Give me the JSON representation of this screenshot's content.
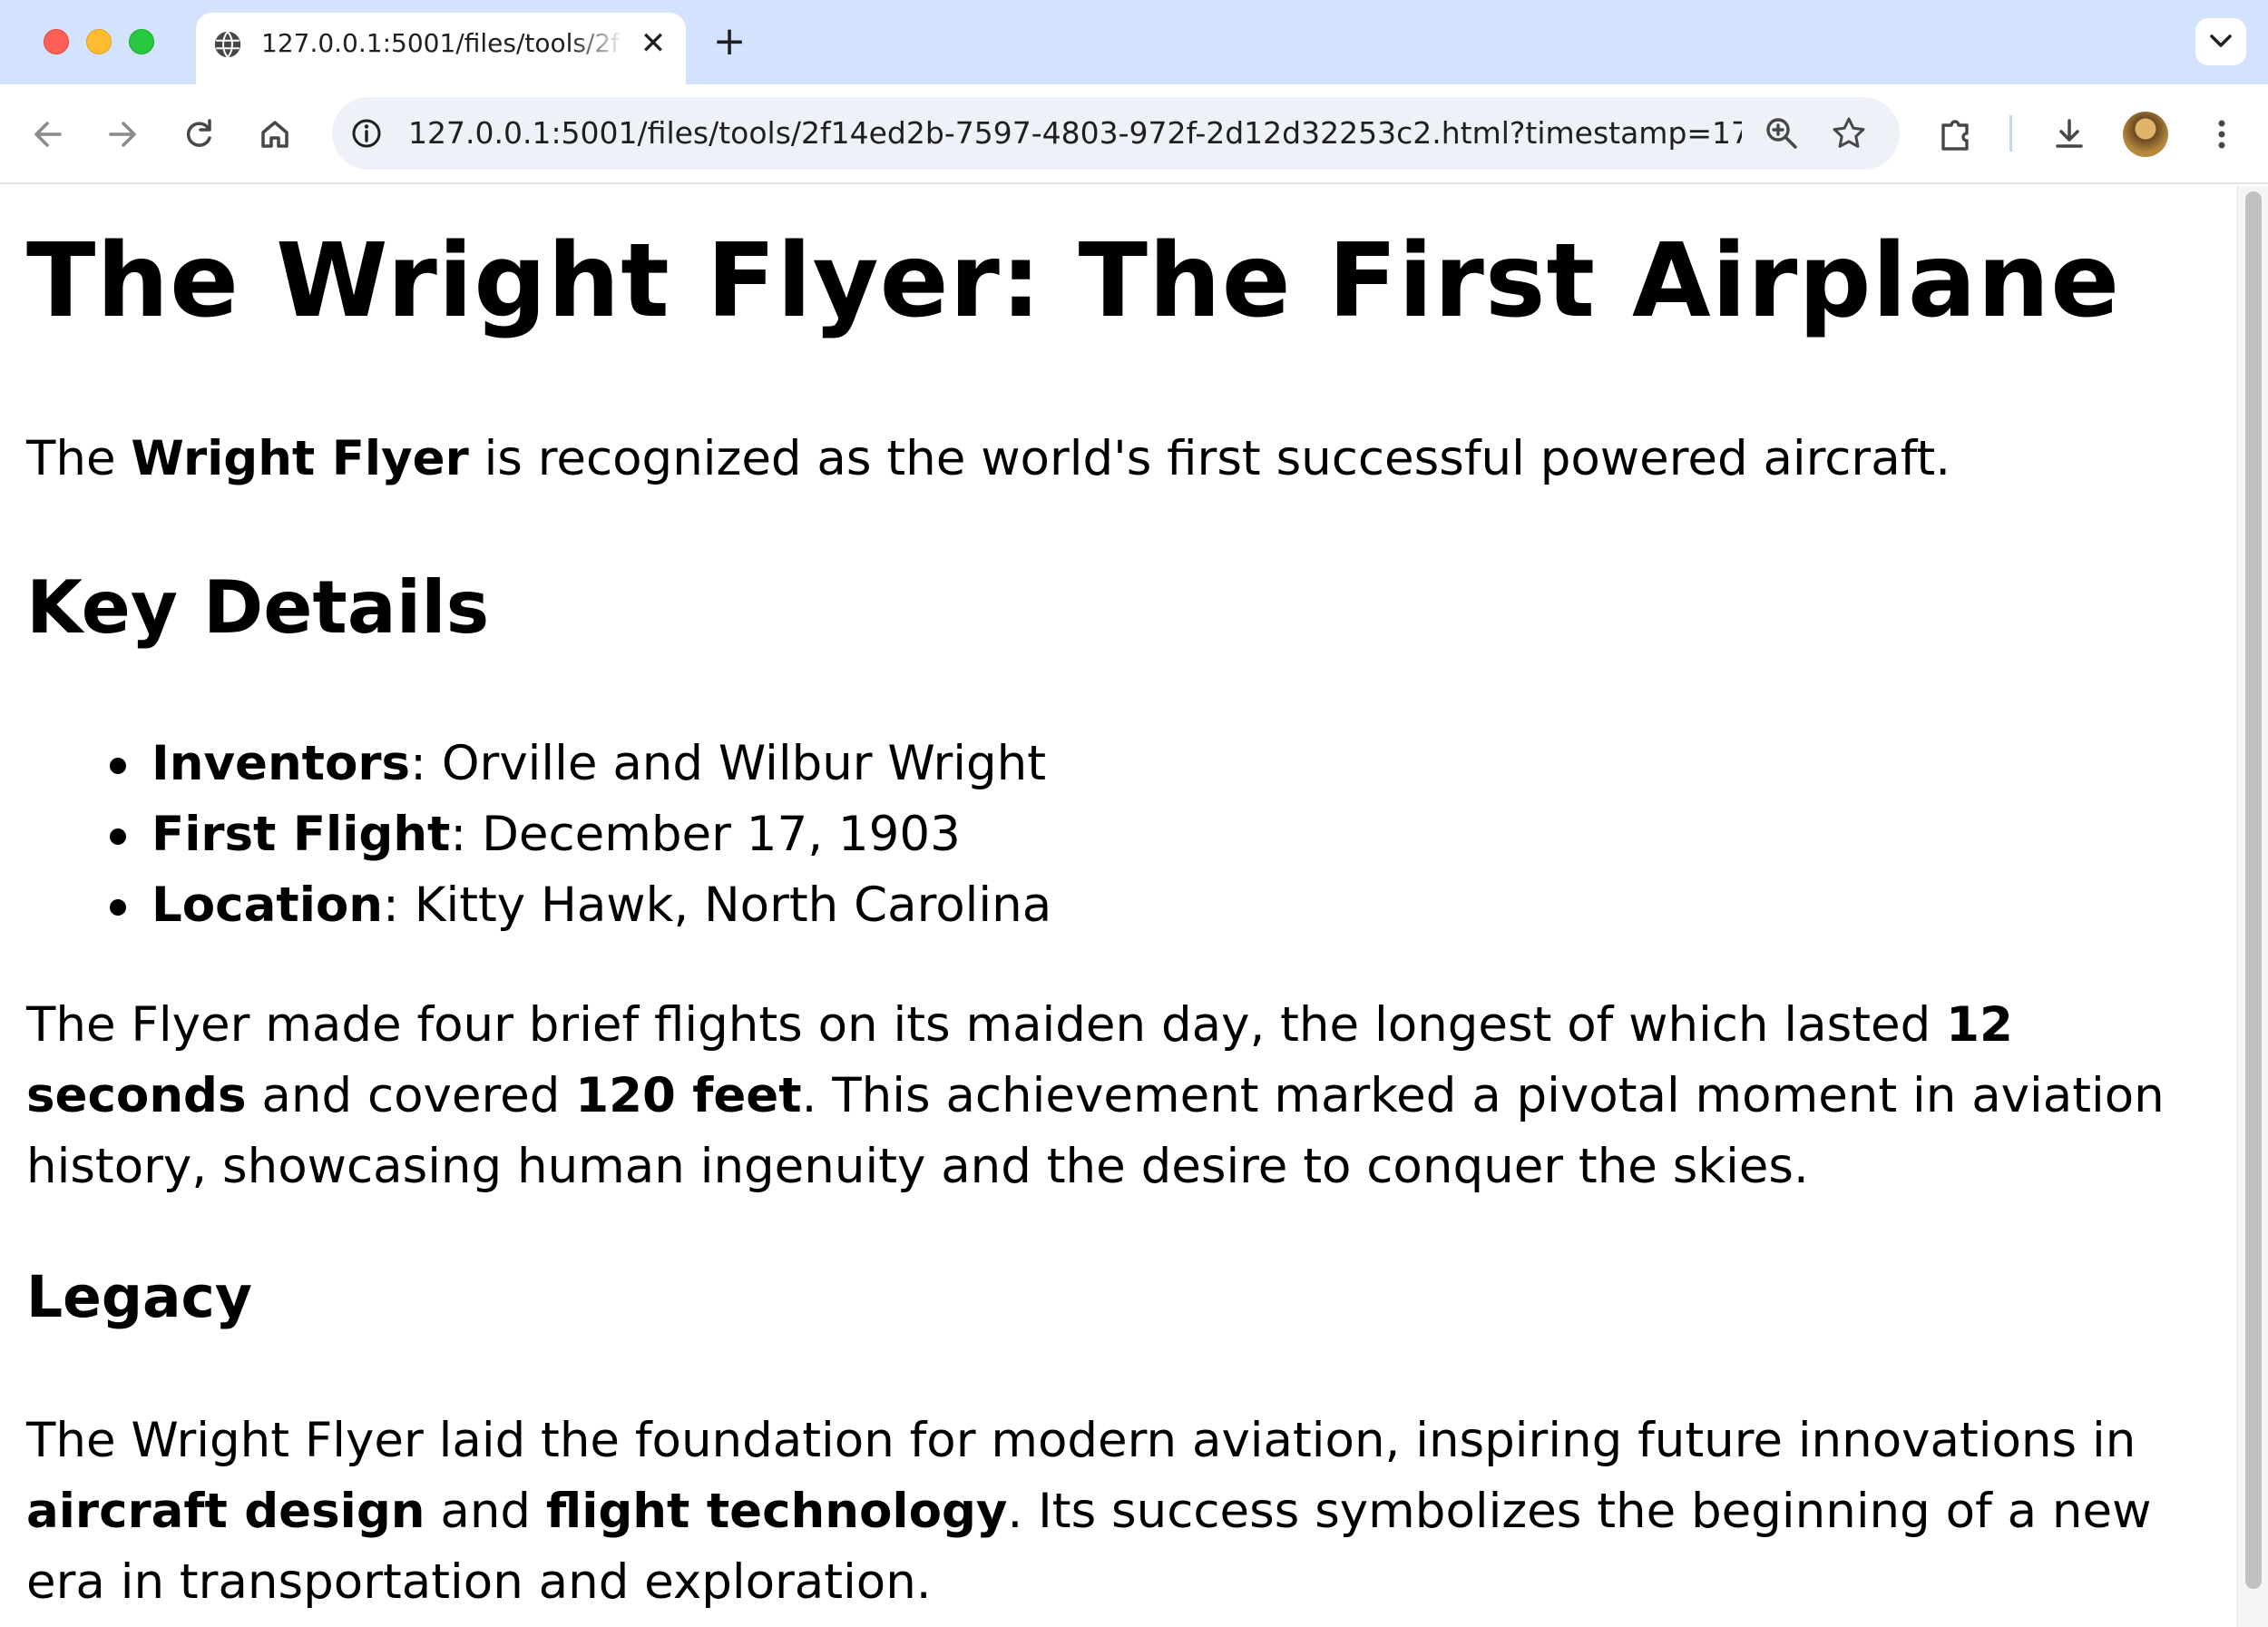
{
  "browser": {
    "tab_title": "127.0.0.1:5001/files/tools/2f14ed2b-7597-4803-972f-2d12d32253c2.html",
    "url": "127.0.0.1:5001/files/tools/2f14ed2b-7597-4803-972f-2d12d32253c2.html?timestamp=17426...",
    "new_tab_symbol": "+",
    "close_tab_symbol": "✕",
    "icons": [
      "globe-icon",
      "back-icon",
      "forward-icon",
      "reload-icon",
      "home-icon",
      "site-info-icon",
      "zoom-icon",
      "bookmark-star-icon",
      "extensions-icon",
      "download-icon",
      "avatar",
      "menu-icon",
      "tab-search-icon"
    ]
  },
  "page": {
    "title": "The Wright Flyer: The First Airplane",
    "intro": {
      "before": "The ",
      "bold": "Wright Flyer",
      "after": " is recognized as the world's first successful powered aircraft."
    },
    "key_details_heading": "Key Details",
    "details": [
      {
        "label": "Inventors",
        "value": ": Orville and Wilbur Wright"
      },
      {
        "label": "First Flight",
        "value": ": December 17, 1903"
      },
      {
        "label": "Location",
        "value": ": Kitty Hawk, North Carolina"
      }
    ],
    "flights": {
      "part1": "The Flyer made four brief flights on its maiden day, the longest of which lasted ",
      "bold1": "12 seconds",
      "part2": " and covered ",
      "bold2": "120 feet",
      "part3": ". This achievement marked a pivotal moment in aviation history, showcasing human ingenuity and the desire to conquer the skies."
    },
    "legacy_heading": "Legacy",
    "legacy": {
      "part1": "The Wright Flyer laid the foundation for modern aviation, inspiring future innovations in ",
      "bold1": "aircraft design",
      "part2": " and ",
      "bold2": "flight technology",
      "part3": ". Its success symbolizes the beginning of a new era in transportation and exploration."
    }
  },
  "colors": {
    "tabstrip_bg": "#d3e3fd",
    "omnibox_bg": "#eef1f8",
    "text": "#000000",
    "chrome_icon": "#474747"
  }
}
